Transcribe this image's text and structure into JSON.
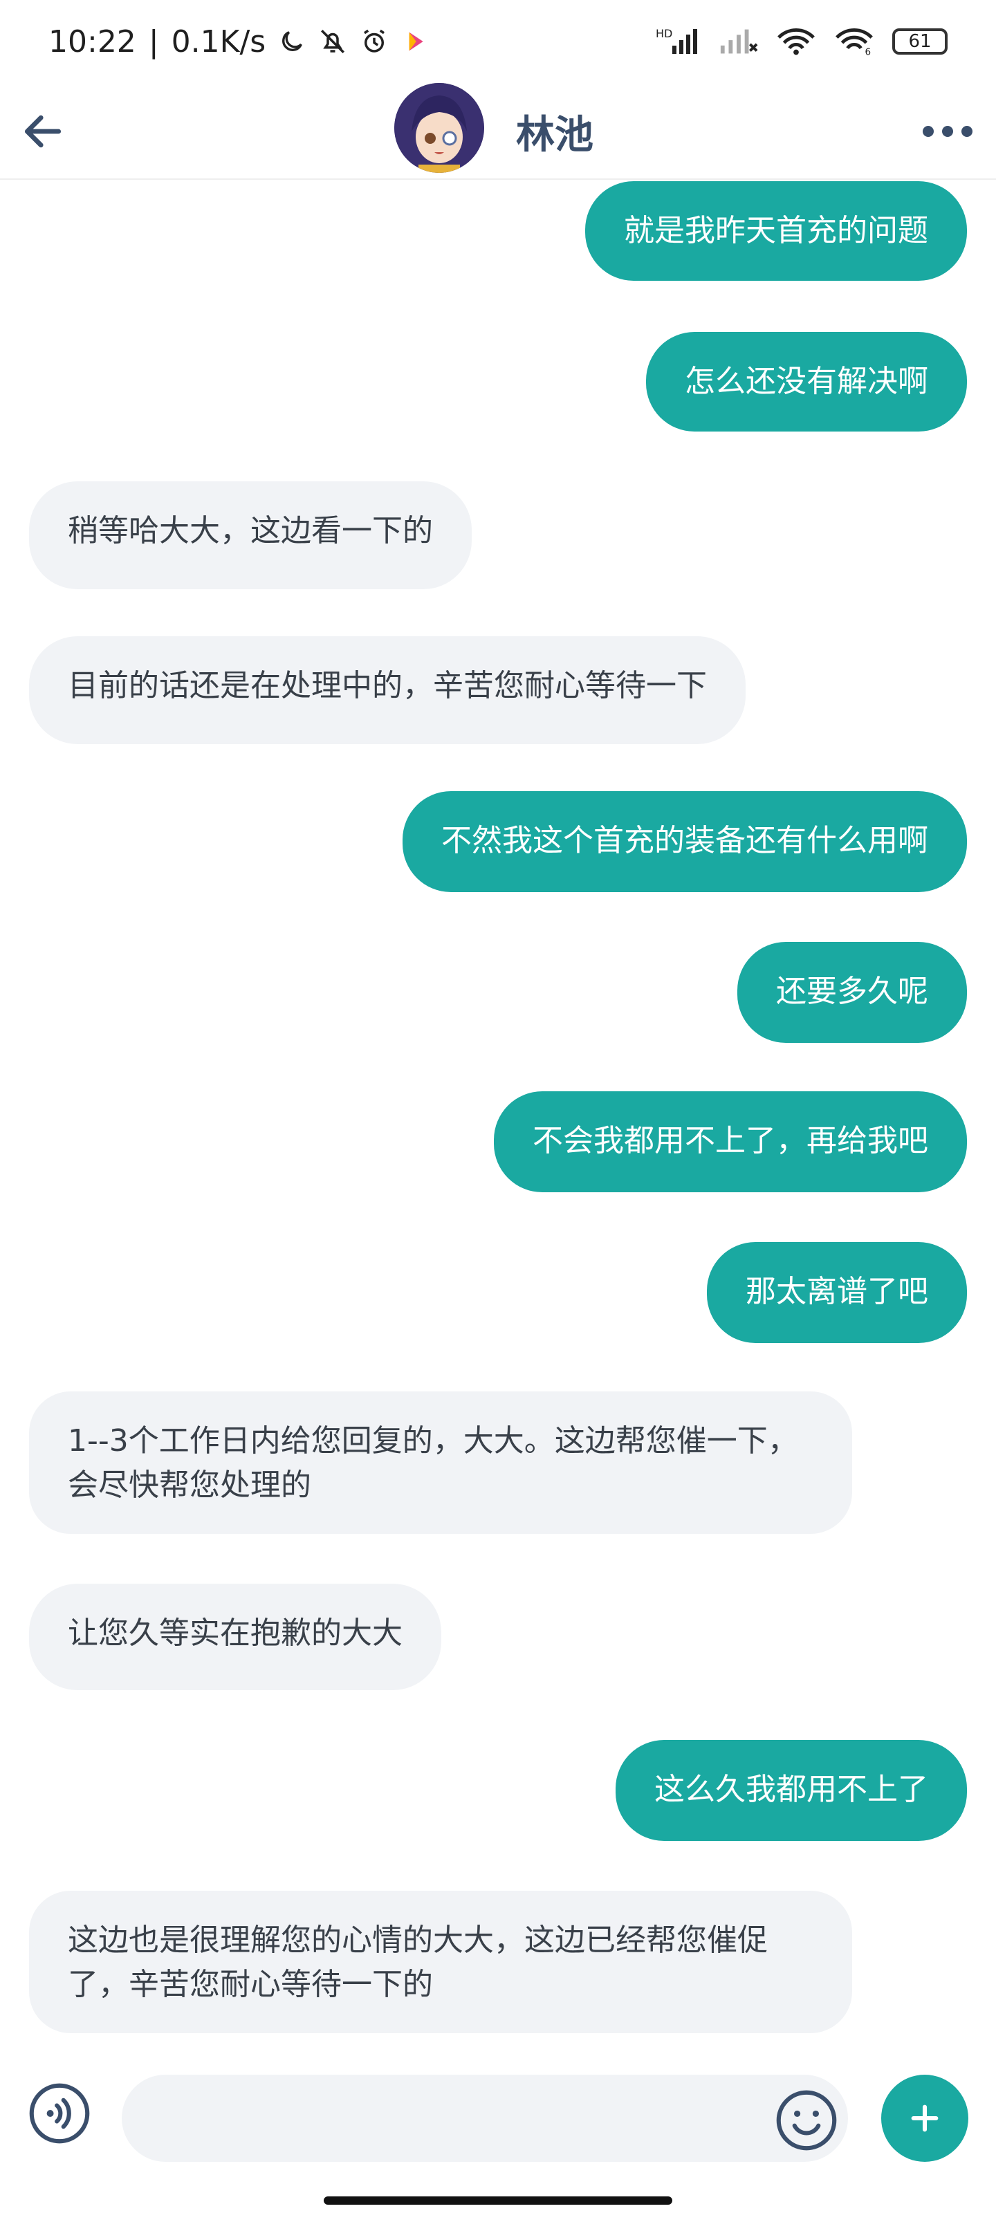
{
  "status_bar": {
    "time": "10:22",
    "speed": "0.1K/s",
    "battery": "61",
    "icons": [
      "moon-icon",
      "bell-off-icon",
      "alarm-icon",
      "app-icon",
      "hd-signal-icon",
      "signal-icon",
      "wifi-icon",
      "wifi6-icon",
      "battery-icon"
    ]
  },
  "header": {
    "back_icon": "arrow-left-icon",
    "contact_name": "林池",
    "more_icon": "more-dots-icon"
  },
  "colors": {
    "outgoing_bubble": "#1aa9a1",
    "incoming_bubble": "#f1f3f6",
    "title": "#3a4e6b"
  },
  "messages": [
    {
      "side": "out",
      "text": "就是我昨天首充的问题"
    },
    {
      "side": "out",
      "text": "怎么还没有解决啊"
    },
    {
      "side": "in",
      "text": "稍等哈大大，这边看一下的"
    },
    {
      "side": "in",
      "text": "目前的话还是在处理中的，辛苦您耐心等待一下"
    },
    {
      "side": "out",
      "text": "不然我这个首充的装备还有什么用啊"
    },
    {
      "side": "out",
      "text": "还要多久呢"
    },
    {
      "side": "out",
      "text": "不会我都用不上了，再给我吧"
    },
    {
      "side": "out",
      "text": "那太离谱了吧"
    },
    {
      "side": "in",
      "text": "1--3个工作日内给您回复的，大大。这边帮您催一下，会尽快帮您处理的"
    },
    {
      "side": "in",
      "text": "让您久等实在抱歉的大大"
    },
    {
      "side": "out",
      "text": "这么久我都用不上了"
    },
    {
      "side": "in",
      "text": "这边也是很理解您的心情的大大，这边已经帮您催促了，辛苦您耐心等待一下的"
    }
  ],
  "composer": {
    "input_value": "",
    "voice_icon": "voice-icon",
    "emoji_icon": "emoji-icon",
    "plus_icon": "plus-icon"
  }
}
